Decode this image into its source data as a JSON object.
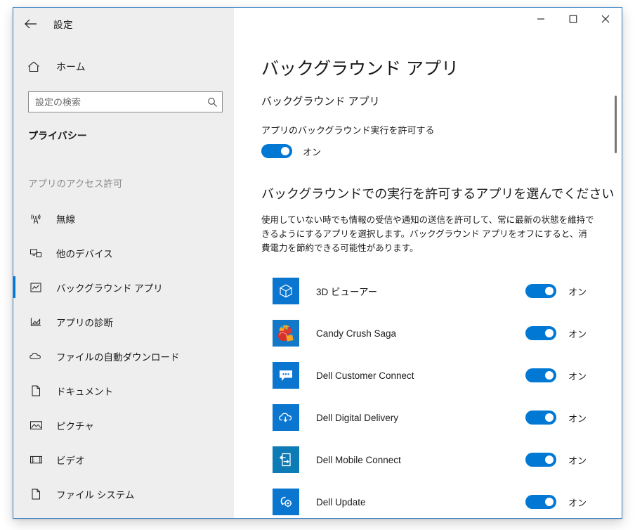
{
  "window": {
    "title": "設定",
    "back_icon": "back-arrow-icon",
    "controls": {
      "minimize": "minimize-icon",
      "maximize": "maximize-icon",
      "close": "close-icon"
    }
  },
  "sidebar": {
    "home_label": "ホーム",
    "home_icon": "home-icon",
    "search": {
      "placeholder": "設定の検索",
      "value": "",
      "icon": "search-icon"
    },
    "category_title": "プライバシー",
    "group_heading": "アプリのアクセス許可",
    "items": [
      {
        "label": "無線",
        "icon": "radio-tower-icon",
        "selected": false
      },
      {
        "label": "他のデバイス",
        "icon": "other-devices-icon",
        "selected": false
      },
      {
        "label": "バックグラウンド アプリ",
        "icon": "background-apps-icon",
        "selected": true
      },
      {
        "label": "アプリの診断",
        "icon": "app-diagnostics-icon",
        "selected": false
      },
      {
        "label": "ファイルの自動ダウンロード",
        "icon": "cloud-download-icon",
        "selected": false
      },
      {
        "label": "ドキュメント",
        "icon": "document-icon",
        "selected": false
      },
      {
        "label": "ピクチャ",
        "icon": "pictures-icon",
        "selected": false
      },
      {
        "label": "ビデオ",
        "icon": "videos-icon",
        "selected": false
      },
      {
        "label": "ファイル システム",
        "icon": "file-system-icon",
        "selected": false
      }
    ]
  },
  "main": {
    "page_title": "バックグラウンド アプリ",
    "section_title": "バックグラウンド アプリ",
    "master_setting_label": "アプリのバックグラウンド実行を許可する",
    "master_toggle_state": "オン",
    "sub_heading": "バックグラウンドでの実行を許可するアプリを選んでください",
    "description": "使用していない時でも情報の受信や通知の送信を許可して、常に最新の状態を維持できるようにするアプリを選択します。バックグラウンド アプリをオフにすると、消費電力を節約できる可能性があります。",
    "apps": [
      {
        "name": "3D ビューアー",
        "icon": "3d-viewer-icon",
        "toggle_state": "オン"
      },
      {
        "name": "Candy Crush Saga",
        "icon": "candy-crush-saga-icon",
        "toggle_state": "オン"
      },
      {
        "name": "Dell Customer Connect",
        "icon": "dell-customer-connect-icon",
        "toggle_state": "オン"
      },
      {
        "name": "Dell Digital Delivery",
        "icon": "dell-digital-delivery-icon",
        "toggle_state": "オン"
      },
      {
        "name": "Dell Mobile Connect",
        "icon": "dell-mobile-connect-icon",
        "toggle_state": "オン"
      },
      {
        "name": "Dell Update",
        "icon": "dell-update-icon",
        "toggle_state": "オン"
      }
    ]
  },
  "colors": {
    "accent": "#0078d4",
    "selection_bar": "#0078d7",
    "sidebar_bg": "#eeeeee",
    "window_border": "#3a84c8"
  }
}
